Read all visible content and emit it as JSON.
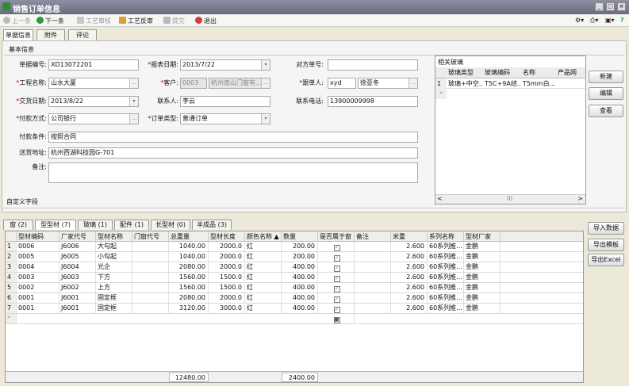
{
  "window": {
    "title": "销售订单信息"
  },
  "toolbar": {
    "prev": "上一条",
    "next": "下一条",
    "process_review": "工艺审核",
    "process_reverse": "工艺反审",
    "submit": "提交",
    "exit": "退出"
  },
  "tabs": [
    "单据信息",
    "附件",
    "评论"
  ],
  "section_basic": "基本信息",
  "form": {
    "doc_no_label": "单据编号:",
    "doc_no": "XD13072201",
    "report_date_label": "报表日期:",
    "report_date": "2013/7/22",
    "partner_no_label": "对方单号:",
    "partner_no": "",
    "project_label": "工程名称:",
    "project": "山水大厦",
    "customer_label": "客户:",
    "customer_code": "0003",
    "customer_name": "杭州南山门窗有...",
    "follower_label": "跟单人:",
    "follower_code": "xyd",
    "follower_name": "徐亚冬",
    "delivery_label": "交货日期:",
    "delivery_date": "2013/8/22",
    "contact_label": "联系人:",
    "contact": "李云",
    "phone_label": "联系电话:",
    "phone": "13900009998",
    "payment_label": "付款方式:",
    "payment": "公司银行",
    "order_type_label": "订单类型:",
    "order_type": "普通订单",
    "pay_terms_label": "付款条件:",
    "pay_terms": "按照合同",
    "address_label": "送货地址:",
    "address": "杭州西湖科技园G-701",
    "remark_label": "备注:",
    "remark": ""
  },
  "related_glass": {
    "title": "相关玻璃",
    "headers": [
      "玻璃类型",
      "玻璃编码",
      "名称",
      "产品网"
    ],
    "rows": [
      [
        "1",
        "玻璃+中空...",
        "T5C+9A结...",
        "T5mm白...",
        ""
      ]
    ],
    "scroll_mid": "III"
  },
  "side_buttons": [
    "新建",
    "编辑",
    "查看"
  ],
  "custom_fields": "自定义字段",
  "detail_tabs": [
    "窗 (2)",
    "型型材 (7)",
    "玻璃 (1)",
    "配件 (1)",
    "长型材 (0)",
    "半成品 (3)"
  ],
  "grid": {
    "headers": [
      "型材编码",
      "厂家代号",
      "型材名称",
      "门窗代号",
      "总重量",
      "型材长度",
      "颜色名称 ▲",
      "数量",
      "是否属于窗",
      "备注",
      "米重",
      "系列名称",
      "型材厂家"
    ],
    "rows": [
      {
        "idx": "1",
        "code": "0006",
        "maker_code": "J6006",
        "name": "大勾起",
        "door_code": "",
        "weight": "1040.00",
        "length": "2000.0",
        "color": "红",
        "qty": "200.00",
        "in_window": true,
        "note": "",
        "m_weight": "2.600",
        "series": "60系列推...",
        "maker": "金鹏"
      },
      {
        "idx": "2",
        "code": "0005",
        "maker_code": "J6005",
        "name": "小勾起",
        "door_code": "",
        "weight": "1040.00",
        "length": "2000.0",
        "color": "红",
        "qty": "200.00",
        "in_window": true,
        "note": "",
        "m_weight": "2.600",
        "series": "60系列推...",
        "maker": "金鹏"
      },
      {
        "idx": "3",
        "code": "0004",
        "maker_code": "J6004",
        "name": "光企",
        "door_code": "",
        "weight": "2080.00",
        "length": "2000.0",
        "color": "红",
        "qty": "400.00",
        "in_window": true,
        "note": "",
        "m_weight": "2.600",
        "series": "60系列推...",
        "maker": "金鹏"
      },
      {
        "idx": "4",
        "code": "0003",
        "maker_code": "J6003",
        "name": "下方",
        "door_code": "",
        "weight": "1560.00",
        "length": "1500.0",
        "color": "红",
        "qty": "400.00",
        "in_window": true,
        "note": "",
        "m_weight": "2.600",
        "series": "60系列推...",
        "maker": "金鹏"
      },
      {
        "idx": "5",
        "code": "0002",
        "maker_code": "J6002",
        "name": "上方",
        "door_code": "",
        "weight": "1560.00",
        "length": "1500.0",
        "color": "红",
        "qty": "400.00",
        "in_window": true,
        "note": "",
        "m_weight": "2.600",
        "series": "60系列推...",
        "maker": "金鹏"
      },
      {
        "idx": "6",
        "code": "0001",
        "maker_code": "J6001",
        "name": "固定框",
        "door_code": "",
        "weight": "2080.00",
        "length": "2000.0",
        "color": "红",
        "qty": "400.00",
        "in_window": true,
        "note": "",
        "m_weight": "2.600",
        "series": "60系列推...",
        "maker": "金鹏"
      },
      {
        "idx": "7",
        "code": "0001",
        "maker_code": "J6001",
        "name": "固定框",
        "door_code": "",
        "weight": "3120.00",
        "length": "3000.0",
        "color": "红",
        "qty": "400.00",
        "in_window": true,
        "note": "",
        "m_weight": "2.600",
        "series": "60系列推...",
        "maker": "金鹏"
      }
    ],
    "total_weight": "12480.00",
    "total_qty": "2400.00"
  },
  "right_buttons": [
    "导入数据",
    "导出模板",
    "导出Excel"
  ]
}
